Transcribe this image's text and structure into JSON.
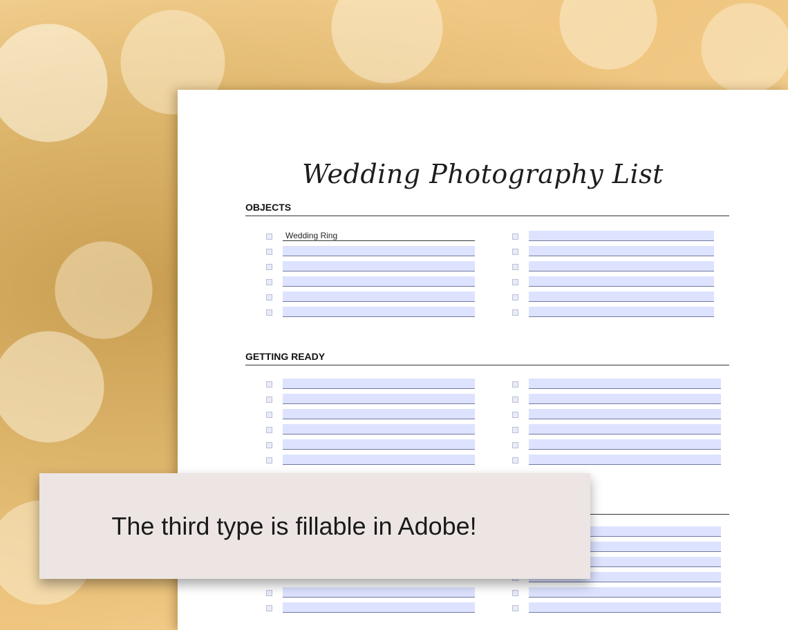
{
  "document": {
    "title": "Wedding Photography List",
    "sections": [
      {
        "heading": "OBJECTS",
        "first_field_value": "Wedding Ring"
      },
      {
        "heading": "GETTING READY"
      }
    ]
  },
  "banner": {
    "text": "The third type is fillable in Adobe!"
  }
}
